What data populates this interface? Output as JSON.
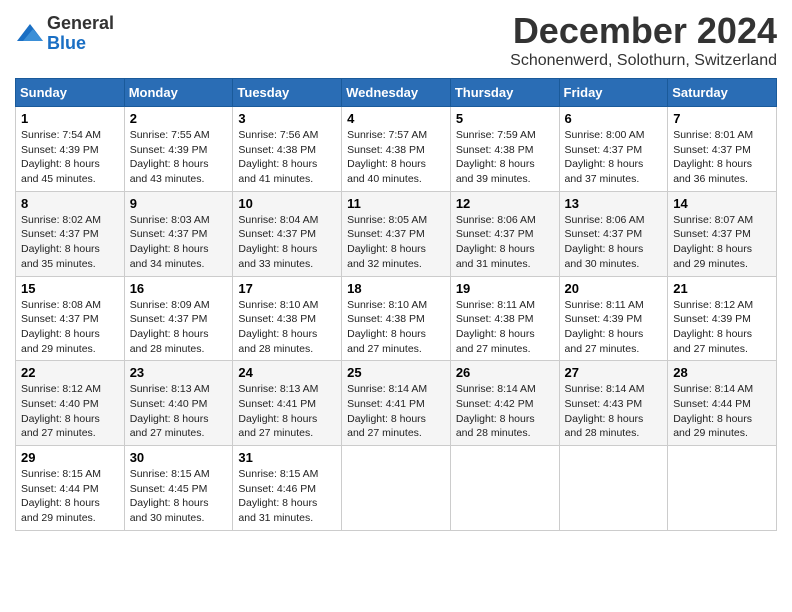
{
  "header": {
    "logo_general": "General",
    "logo_blue": "Blue",
    "month": "December 2024",
    "location": "Schonenwerd, Solothurn, Switzerland"
  },
  "weekdays": [
    "Sunday",
    "Monday",
    "Tuesday",
    "Wednesday",
    "Thursday",
    "Friday",
    "Saturday"
  ],
  "weeks": [
    [
      {
        "day": "1",
        "sunrise": "7:54 AM",
        "sunset": "4:39 PM",
        "daylight": "8 hours and 45 minutes."
      },
      {
        "day": "2",
        "sunrise": "7:55 AM",
        "sunset": "4:39 PM",
        "daylight": "8 hours and 43 minutes."
      },
      {
        "day": "3",
        "sunrise": "7:56 AM",
        "sunset": "4:38 PM",
        "daylight": "8 hours and 41 minutes."
      },
      {
        "day": "4",
        "sunrise": "7:57 AM",
        "sunset": "4:38 PM",
        "daylight": "8 hours and 40 minutes."
      },
      {
        "day": "5",
        "sunrise": "7:59 AM",
        "sunset": "4:38 PM",
        "daylight": "8 hours and 39 minutes."
      },
      {
        "day": "6",
        "sunrise": "8:00 AM",
        "sunset": "4:37 PM",
        "daylight": "8 hours and 37 minutes."
      },
      {
        "day": "7",
        "sunrise": "8:01 AM",
        "sunset": "4:37 PM",
        "daylight": "8 hours and 36 minutes."
      }
    ],
    [
      {
        "day": "8",
        "sunrise": "8:02 AM",
        "sunset": "4:37 PM",
        "daylight": "8 hours and 35 minutes."
      },
      {
        "day": "9",
        "sunrise": "8:03 AM",
        "sunset": "4:37 PM",
        "daylight": "8 hours and 34 minutes."
      },
      {
        "day": "10",
        "sunrise": "8:04 AM",
        "sunset": "4:37 PM",
        "daylight": "8 hours and 33 minutes."
      },
      {
        "day": "11",
        "sunrise": "8:05 AM",
        "sunset": "4:37 PM",
        "daylight": "8 hours and 32 minutes."
      },
      {
        "day": "12",
        "sunrise": "8:06 AM",
        "sunset": "4:37 PM",
        "daylight": "8 hours and 31 minutes."
      },
      {
        "day": "13",
        "sunrise": "8:06 AM",
        "sunset": "4:37 PM",
        "daylight": "8 hours and 30 minutes."
      },
      {
        "day": "14",
        "sunrise": "8:07 AM",
        "sunset": "4:37 PM",
        "daylight": "8 hours and 29 minutes."
      }
    ],
    [
      {
        "day": "15",
        "sunrise": "8:08 AM",
        "sunset": "4:37 PM",
        "daylight": "8 hours and 29 minutes."
      },
      {
        "day": "16",
        "sunrise": "8:09 AM",
        "sunset": "4:37 PM",
        "daylight": "8 hours and 28 minutes."
      },
      {
        "day": "17",
        "sunrise": "8:10 AM",
        "sunset": "4:38 PM",
        "daylight": "8 hours and 28 minutes."
      },
      {
        "day": "18",
        "sunrise": "8:10 AM",
        "sunset": "4:38 PM",
        "daylight": "8 hours and 27 minutes."
      },
      {
        "day": "19",
        "sunrise": "8:11 AM",
        "sunset": "4:38 PM",
        "daylight": "8 hours and 27 minutes."
      },
      {
        "day": "20",
        "sunrise": "8:11 AM",
        "sunset": "4:39 PM",
        "daylight": "8 hours and 27 minutes."
      },
      {
        "day": "21",
        "sunrise": "8:12 AM",
        "sunset": "4:39 PM",
        "daylight": "8 hours and 27 minutes."
      }
    ],
    [
      {
        "day": "22",
        "sunrise": "8:12 AM",
        "sunset": "4:40 PM",
        "daylight": "8 hours and 27 minutes."
      },
      {
        "day": "23",
        "sunrise": "8:13 AM",
        "sunset": "4:40 PM",
        "daylight": "8 hours and 27 minutes."
      },
      {
        "day": "24",
        "sunrise": "8:13 AM",
        "sunset": "4:41 PM",
        "daylight": "8 hours and 27 minutes."
      },
      {
        "day": "25",
        "sunrise": "8:14 AM",
        "sunset": "4:41 PM",
        "daylight": "8 hours and 27 minutes."
      },
      {
        "day": "26",
        "sunrise": "8:14 AM",
        "sunset": "4:42 PM",
        "daylight": "8 hours and 28 minutes."
      },
      {
        "day": "27",
        "sunrise": "8:14 AM",
        "sunset": "4:43 PM",
        "daylight": "8 hours and 28 minutes."
      },
      {
        "day": "28",
        "sunrise": "8:14 AM",
        "sunset": "4:44 PM",
        "daylight": "8 hours and 29 minutes."
      }
    ],
    [
      {
        "day": "29",
        "sunrise": "8:15 AM",
        "sunset": "4:44 PM",
        "daylight": "8 hours and 29 minutes."
      },
      {
        "day": "30",
        "sunrise": "8:15 AM",
        "sunset": "4:45 PM",
        "daylight": "8 hours and 30 minutes."
      },
      {
        "day": "31",
        "sunrise": "8:15 AM",
        "sunset": "4:46 PM",
        "daylight": "8 hours and 31 minutes."
      },
      null,
      null,
      null,
      null
    ]
  ],
  "labels": {
    "sunrise": "Sunrise: ",
    "sunset": "Sunset: ",
    "daylight": "Daylight: "
  }
}
